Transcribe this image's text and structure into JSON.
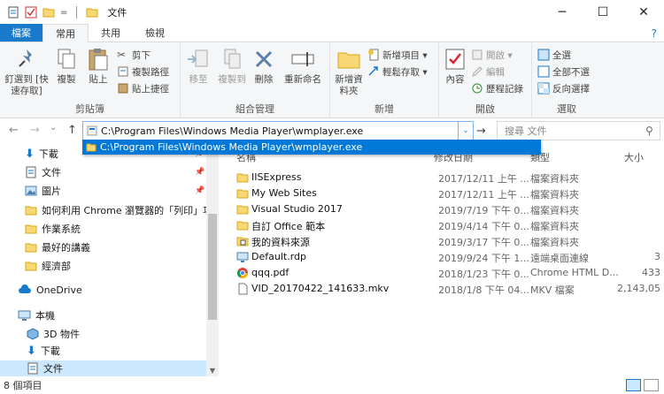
{
  "window": {
    "title": "文件",
    "controls": {
      "minimize": "─",
      "maximize": "☐",
      "close": "✕"
    },
    "qat": {
      "dropdown": "="
    }
  },
  "ribbon_tabs": [
    "檔案",
    "常用",
    "共用",
    "檢視"
  ],
  "ribbon_help": "?",
  "ribbon": {
    "clipboard": {
      "name": "剪貼簿",
      "pin": "釘選到 [快速存取]",
      "copy": "複製",
      "paste": "貼上",
      "cut": "剪下",
      "copy_path": "複製路徑",
      "paste_shortcut": "貼上捷徑"
    },
    "organize": {
      "name": "組合管理",
      "move_to": "移至",
      "copy_to": "複製到",
      "delete": "刪除",
      "rename": "重新命名"
    },
    "new": {
      "name": "新增",
      "new_folder": "新增資料夾",
      "new_item": "新增項目 ▾",
      "easy_access": "輕鬆存取 ▾"
    },
    "open": {
      "name": "開啟",
      "properties": "內容",
      "open": "開啟 ▾",
      "edit": "編輯",
      "history": "歷程記錄"
    },
    "select": {
      "name": "選取",
      "select_all": "全選",
      "select_none": "全部不選",
      "invert": "反向選擇"
    }
  },
  "address": {
    "back": "←",
    "forward": "→",
    "recent": "⌄",
    "up": "↑",
    "value": "C:\\Program Files\\Windows Media Player\\wmplayer.exe",
    "dropdown": "⌄",
    "go": "→",
    "suggestion": "C:\\Program Files\\Windows Media Player\\wmplayer.exe",
    "search_placeholder": "搜尋 文件"
  },
  "nav": {
    "quick_access": [
      {
        "label": "下載",
        "pinned": true
      },
      {
        "label": "文件",
        "pinned": true
      },
      {
        "label": "圖片",
        "pinned": true
      },
      {
        "label": "如何利用 Chrome 瀏覽器的「列印」功能",
        "pinned": false
      },
      {
        "label": "作業系統",
        "pinned": false
      },
      {
        "label": "最好的講義",
        "pinned": false
      },
      {
        "label": "經濟部",
        "pinned": false
      }
    ],
    "onedrive": "OneDrive",
    "this_pc": "本機",
    "pc_items": [
      "3D 物件",
      "下載",
      "文件"
    ]
  },
  "columns": {
    "name": "名稱",
    "date": "修改日期",
    "type": "類型",
    "size": "大小"
  },
  "files": [
    {
      "name": "IISExpress",
      "date": "2017/12/11 上午 ...",
      "type": "檔案資料夾",
      "size": "",
      "icon": "folder"
    },
    {
      "name": "My Web Sites",
      "date": "2017/12/11 上午 ...",
      "type": "檔案資料夾",
      "size": "",
      "icon": "folder"
    },
    {
      "name": "Visual Studio 2017",
      "date": "2019/7/19 下午 0...",
      "type": "檔案資料夾",
      "size": "",
      "icon": "folder"
    },
    {
      "name": "自訂 Office 範本",
      "date": "2019/4/14 下午 0...",
      "type": "檔案資料夾",
      "size": "",
      "icon": "folder"
    },
    {
      "name": "我的資料來源",
      "date": "2019/3/17 下午 0...",
      "type": "檔案資料夾",
      "size": "",
      "icon": "datasource"
    },
    {
      "name": "Default.rdp",
      "date": "2019/9/24 下午 1...",
      "type": "遠端桌面連線",
      "size": "3",
      "icon": "rdp"
    },
    {
      "name": "qqq.pdf",
      "date": "2018/1/23 下午 0...",
      "type": "Chrome HTML D...",
      "size": "433",
      "icon": "chrome"
    },
    {
      "name": "VID_20170422_141633.mkv",
      "date": "2018/1/8 下午 04...",
      "type": "MKV 檔案",
      "size": "2,143,05",
      "icon": "file"
    }
  ],
  "status": {
    "count": "8 個項目"
  }
}
